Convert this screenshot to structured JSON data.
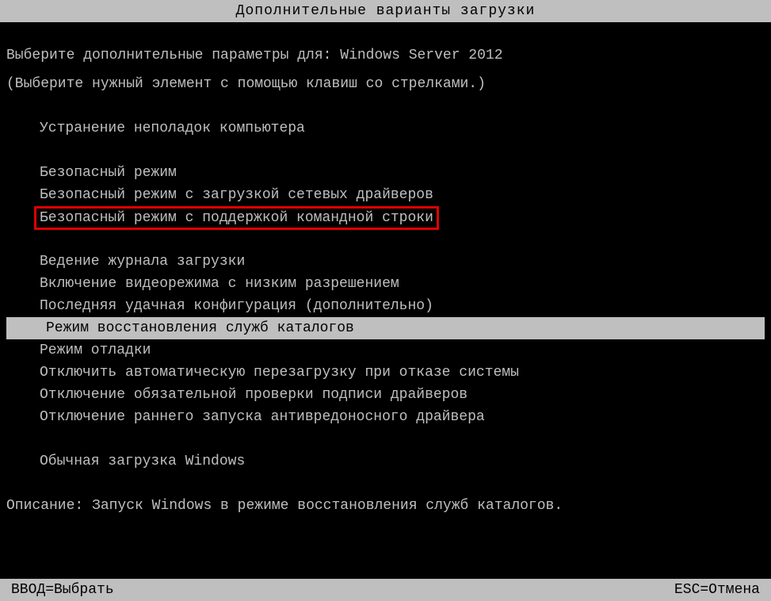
{
  "header": {
    "title": "Дополнительные варианты загрузки"
  },
  "prompt": {
    "prefix": "Выберите дополнительные параметры для: ",
    "os_name": "Windows Server 2012",
    "hint": "(Выберите нужный элемент с помощью клавиш со стрелками.)"
  },
  "menu": {
    "repair": "Устранение неполадок компьютера",
    "safe_mode": "Безопасный режим",
    "safe_mode_net": "Безопасный режим с загрузкой сетевых драйверов",
    "safe_mode_cmd": "Безопасный режим с поддержкой командной строки",
    "boot_log": "Ведение журнала загрузки",
    "low_res": "Включение видеорежима с низким разрешением",
    "last_known": "Последняя удачная конфигурация (дополнительно)",
    "dsrm": "Режим восстановления служб каталогов",
    "debug": "Режим отладки",
    "disable_auto_restart": "Отключить автоматическую перезагрузку при отказе системы",
    "disable_driver_sig": "Отключение обязательной проверки подписи драйверов",
    "disable_elam": "Отключение раннего запуска антивредоносного драйвера",
    "normal": "Обычная загрузка Windows"
  },
  "description": {
    "label": "Описание: ",
    "text": "Запуск Windows в режиме восстановления служб каталогов."
  },
  "footer": {
    "enter": "ВВОД=Выбрать",
    "esc": "ESC=Отмена"
  }
}
